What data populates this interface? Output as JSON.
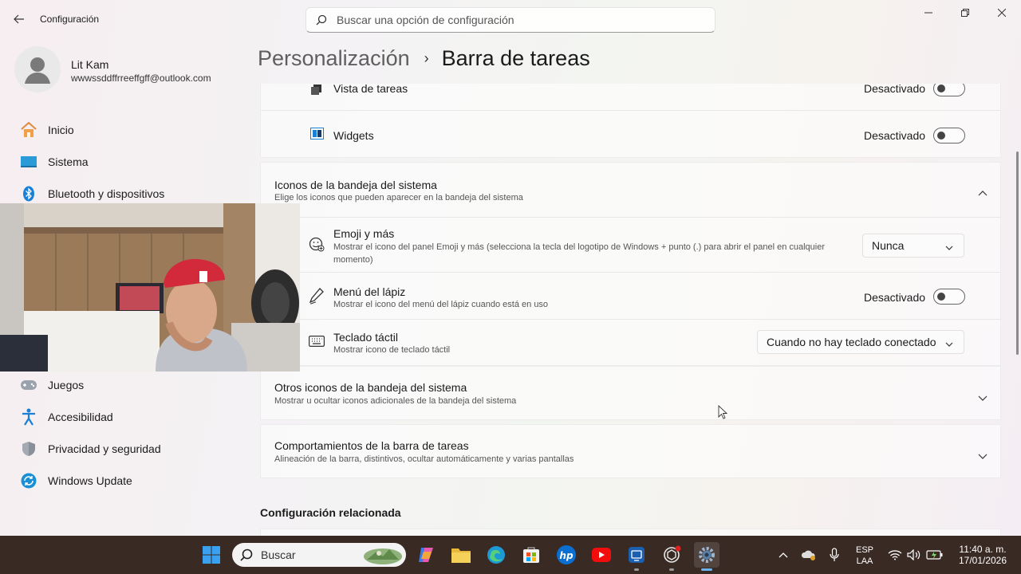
{
  "window": {
    "title": "Configuración",
    "search_placeholder": "Buscar una opción de configuración"
  },
  "profile": {
    "name": "Lit Kam",
    "email": "wwwssddffrreeffgff@outlook.com"
  },
  "sidebar": {
    "items": [
      {
        "label": "Inicio",
        "icon": "home-icon"
      },
      {
        "label": "Sistema",
        "icon": "system-icon"
      },
      {
        "label": "Bluetooth y dispositivos",
        "icon": "bluetooth-icon"
      },
      {
        "label": "Juegos",
        "icon": "gamepad-icon"
      },
      {
        "label": "Accesibilidad",
        "icon": "accessibility-icon"
      },
      {
        "label": "Privacidad y seguridad",
        "icon": "shield-icon"
      },
      {
        "label": "Windows Update",
        "icon": "update-icon"
      }
    ]
  },
  "breadcrumb": {
    "parent": "Personalización",
    "separator": "›",
    "current": "Barra de tareas"
  },
  "taskbar_items": {
    "task_view": {
      "title": "Vista de tareas",
      "state": "Desactivado",
      "on": false
    },
    "widgets": {
      "title": "Widgets",
      "state": "Desactivado",
      "on": false
    }
  },
  "system_tray_icons": {
    "title": "Iconos de la bandeja del sistema",
    "description": "Elige los iconos que pueden aparecer en la bandeja del sistema",
    "emoji": {
      "title": "Emoji y más",
      "description": "Mostrar el icono del panel Emoji y más (selecciona la tecla del logotipo de Windows + punto (.) para abrir el panel en cualquier momento)",
      "value": "Nunca"
    },
    "pen": {
      "title": "Menú del lápiz",
      "description": "Mostrar el icono del menú del lápiz cuando está en uso",
      "state": "Desactivado",
      "on": false
    },
    "touch_keyboard": {
      "title": "Teclado táctil",
      "description": "Mostrar icono de teclado táctil",
      "value": "Cuando no hay teclado conectado"
    }
  },
  "other_tray_icons": {
    "title": "Otros iconos de la bandeja del sistema",
    "description": "Mostrar u ocultar iconos adicionales de la bandeja del sistema"
  },
  "taskbar_behaviors": {
    "title": "Comportamientos de la barra de tareas",
    "description": "Alineación de la barra, distintivos, ocultar automáticamente y varias pantallas"
  },
  "related": {
    "header": "Configuración relacionada"
  },
  "taskbar": {
    "search_label": "Buscar",
    "language_top": "ESP",
    "language_bottom": "LAA",
    "time": "11:40 a. m.",
    "date": "17/01/2026"
  },
  "colors": {
    "accent": "#0067c0",
    "taskbar_bg": "#3a2a24"
  }
}
